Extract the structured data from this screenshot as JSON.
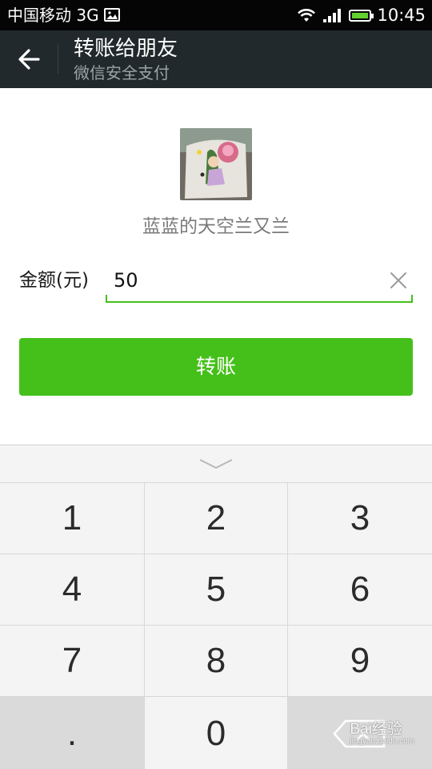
{
  "status_bar": {
    "carrier": "中国移动 3G",
    "time": "10:45"
  },
  "header": {
    "title": "转账给朋友",
    "subtitle": "微信安全支付"
  },
  "recipient": {
    "name": "蓝蓝的天空兰又兰"
  },
  "amount": {
    "label": "金额(元)",
    "value": "50"
  },
  "transfer_button": {
    "label": "转账"
  },
  "keypad": {
    "keys": [
      "1",
      "2",
      "3",
      "4",
      "5",
      "6",
      "7",
      "8",
      "9",
      ".",
      "0"
    ]
  },
  "watermark": {
    "text": "Bai经验",
    "url": "jingyan.baidu.com"
  },
  "colors": {
    "accent": "#45c01a",
    "header_bg": "#21292c",
    "status_bg": "#050505"
  }
}
